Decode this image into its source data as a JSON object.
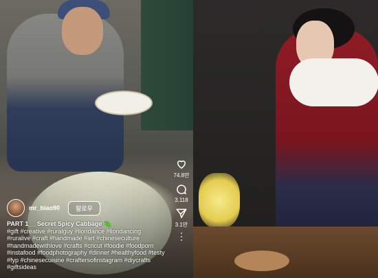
{
  "left_post": {
    "username": "mr_biao90",
    "follow_label": "팔로우",
    "caption_title": "PART 1__ Secret Spicy Cabbage",
    "caption_title_icon": "leaf-icon",
    "hashtags": "#gift #creative #ruralguy #liondance #liondancing #ruralive #craft #handmade #art #chineseculture #handmadewithlove #crafts #cricut #foodie #foodporn #instafood #foodphotography #dinner #healthyfood #testy #fyp #chinesecuisine #craftersofinstagram #diycrafts #giftsideas"
  },
  "actions": {
    "likes": "74.8만",
    "comments": "3,118",
    "shares": "3.1만",
    "more_icon": "⋮"
  },
  "icons": {
    "like": "heart-icon",
    "comment": "comment-icon",
    "share": "send-icon",
    "more": "more-vertical-icon"
  },
  "colors": {
    "text": "#ffffff",
    "leaf": "#5cb83a"
  }
}
